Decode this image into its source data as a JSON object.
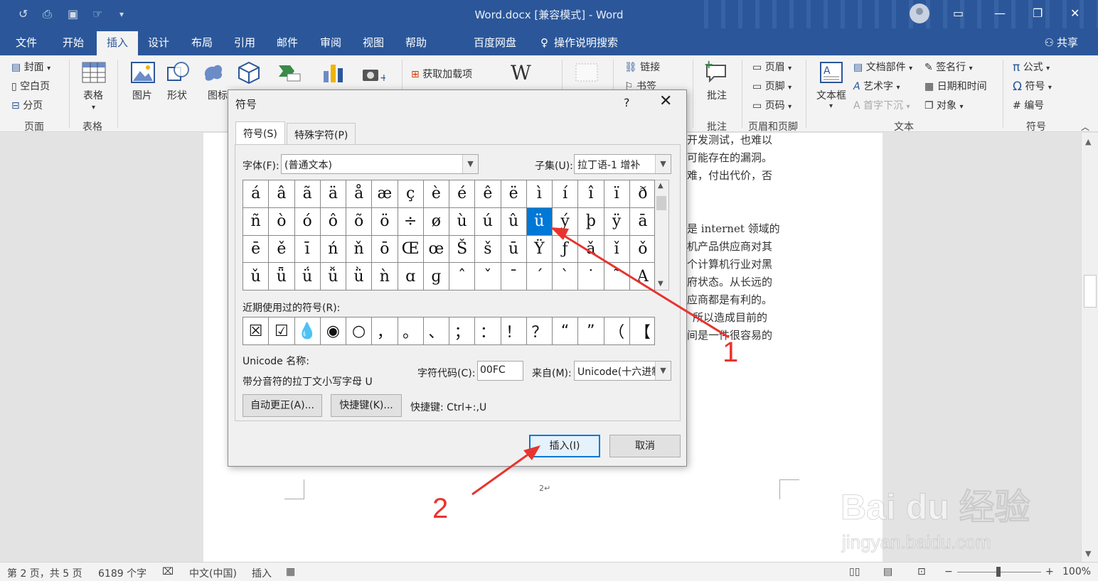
{
  "titlebar": {
    "title": "Word.docx [兼容模式]  -  Word",
    "dropdown_glyph": "▾"
  },
  "tabs": {
    "items": [
      "文件",
      "开始",
      "插入",
      "设计",
      "布局",
      "引用",
      "邮件",
      "审阅",
      "视图",
      "帮助",
      "百度网盘",
      "操作说明搜索"
    ],
    "active": "插入",
    "share": "共享"
  },
  "ribbon": {
    "pages": {
      "cover": "封面",
      "blank": "空白页",
      "break": "分页",
      "group": "页面"
    },
    "tables": {
      "table": "表格",
      "group": "表格"
    },
    "illustrations": {
      "picture": "图片",
      "shape": "形状",
      "icon": "图标"
    },
    "addins": {
      "get": "获取加载项"
    },
    "links": {
      "link": "链接",
      "bookmark": "书签"
    },
    "comments": {
      "comment": "批注",
      "group": "批注"
    },
    "headerfooter": {
      "header": "页眉",
      "footer": "页脚",
      "pagenum": "页码",
      "group": "页眉和页脚"
    },
    "text": {
      "textbox": "文本框",
      "parts": "文档部件",
      "wordart": "艺术字",
      "dropcap": "首字下沉",
      "signature": "签名行",
      "datetime": "日期和时间",
      "object": "对象",
      "group": "文本"
    },
    "symbols": {
      "equation": "公式",
      "symbol": "符号",
      "number": "编号",
      "group": "符号"
    }
  },
  "document": {
    "lines": [
      "开发测试，也难以",
      "可能存在的漏洞。",
      "难，付出代价，否",
      "是 internet 领域的",
      "机产品供应商对其",
      "个计算机行业对黑",
      "府状态。从长远的",
      "应商都是有利的。",
      "所以造成目前的",
      "间是一件很容易的"
    ],
    "page_number": "2↵"
  },
  "dialog": {
    "title": "符号",
    "help": "?",
    "close": "✕",
    "tab_symbols": "符号(S)",
    "tab_special": "特殊字符(P)",
    "font_label": "字体(F):",
    "font_value": "(普通文本)",
    "subset_label": "子集(U):",
    "subset_value": "拉丁语-1 增补",
    "symbols": [
      "á",
      "â",
      "ã",
      "ä",
      "å",
      "æ",
      "ç",
      "è",
      "é",
      "ê",
      "ë",
      "ì",
      "í",
      "î",
      "ï",
      "ð",
      "ñ",
      "ò",
      "ó",
      "ô",
      "õ",
      "ö",
      "÷",
      "ø",
      "ù",
      "ú",
      "û",
      "ü",
      "ý",
      "þ",
      "ÿ",
      "ā",
      "ē",
      "ě",
      "ī",
      "ń",
      "ň",
      "ō",
      "Œ",
      "œ",
      "Š",
      "š",
      "ū",
      "Ÿ",
      "ƒ",
      "ǎ",
      "ǐ",
      "ǒ",
      "ǔ",
      "ǖ",
      "ǘ",
      "ǚ",
      "ǜ",
      "ǹ",
      "ɑ",
      "ɡ",
      "ˆ",
      "ˇ",
      "ˉ",
      "ˊ",
      "ˋ",
      "˙",
      "˜",
      "Α"
    ],
    "selected_symbol": "ü",
    "recent_label": "近期使用过的符号(R):",
    "recent": [
      "☒",
      "☑",
      "💧",
      "◉",
      "○",
      "，",
      "。",
      "、",
      "；",
      "：",
      "！",
      "？",
      "“",
      "”",
      "（",
      "【"
    ],
    "unicode_name_label": "Unicode 名称:",
    "unicode_name": "带分音符的拉丁文小写字母 U",
    "charcode_label": "字符代码(C):",
    "charcode_value": "00FC",
    "from_label": "来自(M):",
    "from_value": "Unicode(十六进制)",
    "autocorrect": "自动更正(A)...",
    "shortcut_key": "快捷键(K)...",
    "shortcut_text": "快捷键: Ctrl+:,U",
    "insert": "插入(I)",
    "cancel": "取消"
  },
  "statusbar": {
    "page": "第 2 页，共 5 页",
    "words": "6189 个字",
    "language": "中文(中国)",
    "mode": "插入",
    "zoom_minus": "−",
    "zoom_plus": "+",
    "zoom_level": "100%"
  },
  "annotations": {
    "one": "1",
    "two": "2"
  },
  "watermark": {
    "main": "Bai du 经验",
    "sub": "jingyan.baidu.com"
  },
  "colors": {
    "accent": "#2b579a",
    "selection": "#0078d7",
    "annotation": "#e8342f"
  }
}
